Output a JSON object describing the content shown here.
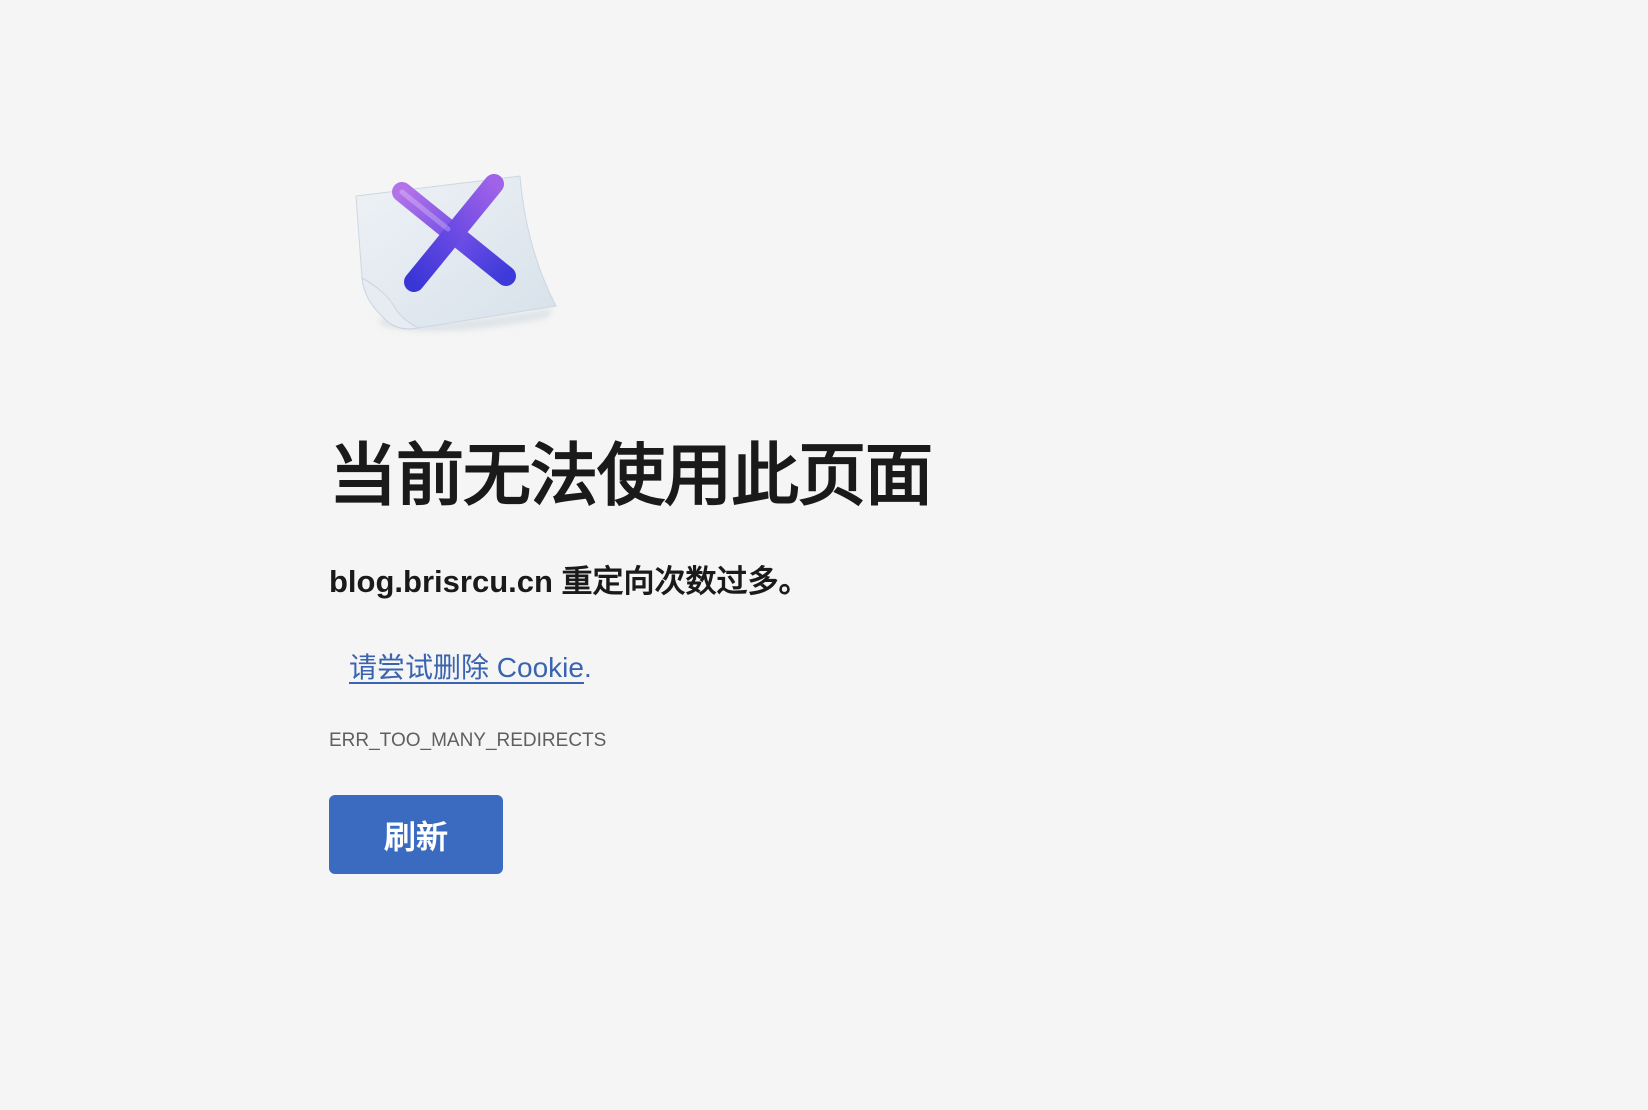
{
  "error_page": {
    "illustration_icon": "document-x-icon",
    "title": "当前无法使用此页面",
    "message": "blog.brisrcu.cn 重定向次数过多。",
    "suggestion_link": "请尝试删除 Cookie",
    "suggestion_suffix": ".",
    "error_code": "ERR_TOO_MANY_REDIRECTS",
    "reload_button": "刷新"
  },
  "colors": {
    "background": "#f5f5f5",
    "title_text": "#1a1a1a",
    "link": "#3a64b0",
    "error_code_text": "#5f5f5f",
    "button_background": "#3a6bc1",
    "button_text": "#ffffff",
    "x_mark_top": "#b06ee6",
    "x_mark_bottom": "#4a3ee0"
  }
}
